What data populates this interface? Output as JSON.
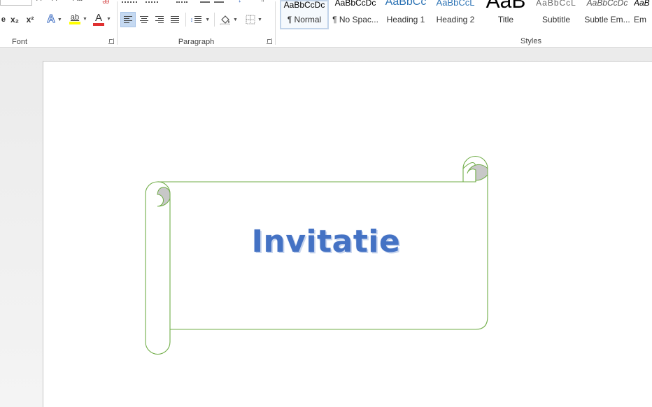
{
  "ribbon": {
    "font": {
      "label": "Font",
      "clear_formatting_glyph": "ꭂ",
      "subscript": "x₂",
      "superscript": "x²",
      "text_effects_letter": "A",
      "highlight_letters": "ab",
      "font_color_letter": "A",
      "highlight_color": "#ffff00",
      "font_color": "#e03030"
    },
    "paragraph": {
      "label": "Paragraph",
      "sort_glyph": "↕"
    },
    "styles": {
      "label": "Styles",
      "items": [
        {
          "preview": "AaBbCcDc",
          "name": "¶ Normal"
        },
        {
          "preview": "AaBbCcDc",
          "name": "¶ No Spac..."
        },
        {
          "preview": "AaBbCc",
          "name": "Heading 1"
        },
        {
          "preview": "AaBbCcL",
          "name": "Heading 2"
        },
        {
          "preview": "AaB",
          "name": "Title"
        },
        {
          "preview": "AaBbCcL",
          "name": "Subtitle"
        },
        {
          "preview": "AaBbCcDc",
          "name": "Subtle Em..."
        },
        {
          "preview": "AaB",
          "name": "Em"
        }
      ]
    }
  },
  "document": {
    "title_text": "Invitatie",
    "scroll_outline_color": "#70ad47",
    "scroll_curl_color": "#c8c8c8"
  }
}
